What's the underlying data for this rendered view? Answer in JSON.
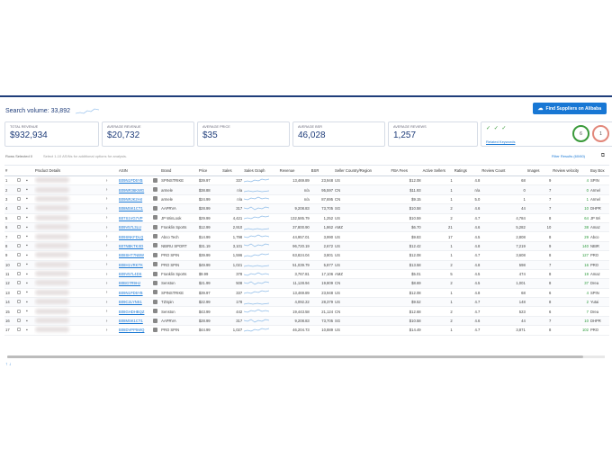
{
  "header": {
    "search_volume": "Search volume: 33,892",
    "alibaba_button": "Find Suppliers on Alibaba",
    "alibaba_icon": "alibaba-icon"
  },
  "stats": {
    "total_revenue_label": "TOTAL REVENUE",
    "total_revenue": "$932,934",
    "avg_revenue_label": "AVERAGE REVENUE",
    "avg_revenue": "$20,732",
    "avg_price_label": "AVERAGE PRICE",
    "avg_price": "$35",
    "avg_bsr_label": "AVERAGE BSR",
    "avg_bsr": "46,028",
    "avg_reviews_label": "AVERAGE REVIEWS",
    "avg_reviews": "1,257",
    "related_keywords": "Related Keywords",
    "ring_green": "6",
    "ring_red": "1"
  },
  "toolbar": {
    "rows_selected": "Rows Selected 0",
    "hint": "Select 1-10 ASINs for additional options for analysis.",
    "filter_results": "Filter Results (60/60)"
  },
  "columns": [
    "#",
    "",
    "",
    "Product Details",
    "",
    "ASIN",
    "",
    "Brand",
    "Price",
    "Sales",
    "Sales Graph",
    "Revenue",
    "BSR",
    "Seller Country/Region",
    "FBA Fees",
    "Active Sellers",
    "Ratings",
    "Review Count",
    "Images",
    "Review velocity",
    "Buy Box"
  ],
  "rows": [
    {
      "n": "1",
      "asin": "B09N1PD5YB",
      "brand": "SPINSTRIKE",
      "price": "$39.97",
      "sales": "337",
      "revenue": "13,469.89",
      "bsr": "23,948",
      "country": "US",
      "fba": "$12.08",
      "sellers": "1",
      "rating": "4.8",
      "reviews": "68",
      "images": "9",
      "velocity": "4",
      "buybox": "SPIN"
    },
    {
      "n": "2",
      "asin": "B09NR36KWG",
      "brand": "armele",
      "price": "$38.88",
      "sales": "n/a",
      "revenue": "n/a",
      "bsr": "95,597",
      "country": "CN",
      "fba": "$11.93",
      "sellers": "1",
      "rating": "n/a",
      "reviews": "0",
      "images": "7",
      "velocity": "0",
      "buybox": "Armel"
    },
    {
      "n": "3",
      "asin": "B09NRJK2H4",
      "brand": "armele",
      "price": "$24.99",
      "sales": "n/a",
      "revenue": "n/a",
      "bsr": "87,695",
      "country": "CN",
      "fba": "$9.15",
      "sellers": "1",
      "rating": "5.0",
      "reviews": "1",
      "images": "7",
      "velocity": "1",
      "buybox": "Armel"
    },
    {
      "n": "4",
      "asin": "B08MSK1CT1",
      "brand": "AAPRVA",
      "price": "$28.99",
      "sales": "317",
      "revenue": "9,208.83",
      "bsr": "73,705",
      "country": "SG",
      "fba": "$10.58",
      "sellers": "2",
      "rating": "4.6",
      "reviews": "44",
      "images": "7",
      "velocity": "10",
      "buybox": "DHPR"
    },
    {
      "n": "5",
      "asin": "B07S1VG7VP",
      "brand": "JP WinLook",
      "price": "$29.99",
      "sales": "4,421",
      "revenue": "132,585.79",
      "bsr": "1,252",
      "country": "US",
      "fba": "$10.59",
      "sellers": "2",
      "rating": "4.7",
      "reviews": "4,784",
      "images": "8",
      "velocity": "64",
      "buybox": "JP Wi"
    },
    {
      "n": "6",
      "asin": "B09V57L3LU",
      "brand": "Franklin Sports",
      "price": "$12.99",
      "sales": "2,910",
      "revenue": "37,800.90",
      "bsr": "1,862",
      "country": "AMZ",
      "fba": "$6.70",
      "sellers": "21",
      "rating": "4.6",
      "reviews": "5,282",
      "images": "10",
      "velocity": "38",
      "buybox": "Amaz"
    },
    {
      "n": "7",
      "asin": "B09SNKFDLQ",
      "brand": "Abco Tech",
      "price": "$14.99",
      "sales": "1,798",
      "revenue": "44,957.01",
      "bsr": "3,990",
      "country": "US",
      "fba": "$9.83",
      "sellers": "17",
      "rating": "4.5",
      "reviews": "2,808",
      "images": "8",
      "velocity": "29",
      "buybox": "Abco"
    },
    {
      "n": "8",
      "asin": "B07NBKTKXD",
      "brand": "NBIRU SPORT",
      "price": "$31.19",
      "sales": "3,101",
      "revenue": "96,720.19",
      "bsr": "2,672",
      "country": "US",
      "fba": "$12.42",
      "sellers": "1",
      "rating": "4.8",
      "reviews": "7,219",
      "images": "9",
      "velocity": "140",
      "buybox": "NBIR"
    },
    {
      "n": "9",
      "asin": "B08SHT7NBW",
      "brand": "PRO SPIN",
      "price": "$39.99",
      "sales": "1,596",
      "revenue": "63,824.04",
      "bsr": "3,801",
      "country": "US",
      "fba": "$12.08",
      "sellers": "1",
      "rating": "4.7",
      "reviews": "3,608",
      "images": "8",
      "velocity": "127",
      "buybox": "PRO"
    },
    {
      "n": "10",
      "asin": "B08H1VRKTK",
      "brand": "PRO SPIN",
      "price": "$49.99",
      "sales": "1,021",
      "revenue": "51,039.79",
      "bsr": "5,877",
      "country": "US",
      "fba": "$13.58",
      "sellers": "2",
      "rating": "4.8",
      "reviews": "598",
      "images": "7",
      "velocity": "16",
      "buybox": "PRO"
    },
    {
      "n": "11",
      "asin": "B09V57L4DS",
      "brand": "Franklin Sports",
      "price": "$9.99",
      "sales": "378",
      "revenue": "3,767.81",
      "bsr": "17,106",
      "country": "AMZ",
      "fba": "$5.01",
      "sellers": "5",
      "rating": "4.5",
      "reviews": "474",
      "images": "8",
      "velocity": "19",
      "buybox": "Amaz"
    },
    {
      "n": "12",
      "asin": "B0BG7R9HJ",
      "brand": "Senston",
      "price": "$21.99",
      "sales": "508",
      "revenue": "11,128.94",
      "bsr": "19,809",
      "country": "CN",
      "fba": "$8.69",
      "sellers": "2",
      "rating": "4.5",
      "reviews": "1,001",
      "images": "8",
      "velocity": "37",
      "buybox": "Drea"
    },
    {
      "n": "13",
      "asin": "B09N1PD5YB",
      "brand": "SPINSTRIKE",
      "price": "$39.97",
      "sales": "337",
      "revenue": "13,469.89",
      "bsr": "23,948",
      "country": "US",
      "fba": "$12.08",
      "sellers": "1",
      "rating": "4.8",
      "reviews": "68",
      "images": "6",
      "velocity": "4",
      "buybox": "SPIN"
    },
    {
      "n": "14",
      "asin": "B09C2LYNS1",
      "brand": "TZSpin",
      "price": "$22.99",
      "sales": "178",
      "revenue": "4,092.22",
      "bsr": "28,379",
      "country": "US",
      "fba": "$9.52",
      "sellers": "1",
      "rating": "4.7",
      "reviews": "148",
      "images": "8",
      "velocity": "2",
      "buybox": "Yutai"
    },
    {
      "n": "15",
      "asin": "B08GHDHBQZ",
      "brand": "Senston",
      "price": "$43.99",
      "sales": "442",
      "revenue": "19,443.58",
      "bsr": "21,124",
      "country": "CN",
      "fba": "$12.68",
      "sellers": "2",
      "rating": "4.7",
      "reviews": "523",
      "images": "6",
      "velocity": "7",
      "buybox": "Drea"
    },
    {
      "n": "16",
      "asin": "B08MSK1CT1",
      "brand": "AAPRVA",
      "price": "$28.99",
      "sales": "317",
      "revenue": "9,208.83",
      "bsr": "73,705",
      "country": "SG",
      "fba": "$10.58",
      "sellers": "2",
      "rating": "4.6",
      "reviews": "44",
      "images": "7",
      "velocity": "10",
      "buybox": "DHPR"
    },
    {
      "n": "17",
      "asin": "B08DVPP5WQ",
      "brand": "PRO SPIN",
      "price": "$44.99",
      "sales": "1,027",
      "revenue": "46,204.73",
      "bsr": "10,889",
      "country": "US",
      "fba": "$14.49",
      "sellers": "1",
      "rating": "4.7",
      "reviews": "3,871",
      "images": "8",
      "velocity": "102",
      "buybox": "PRO"
    }
  ],
  "footer_fragment": "↑ ↓"
}
